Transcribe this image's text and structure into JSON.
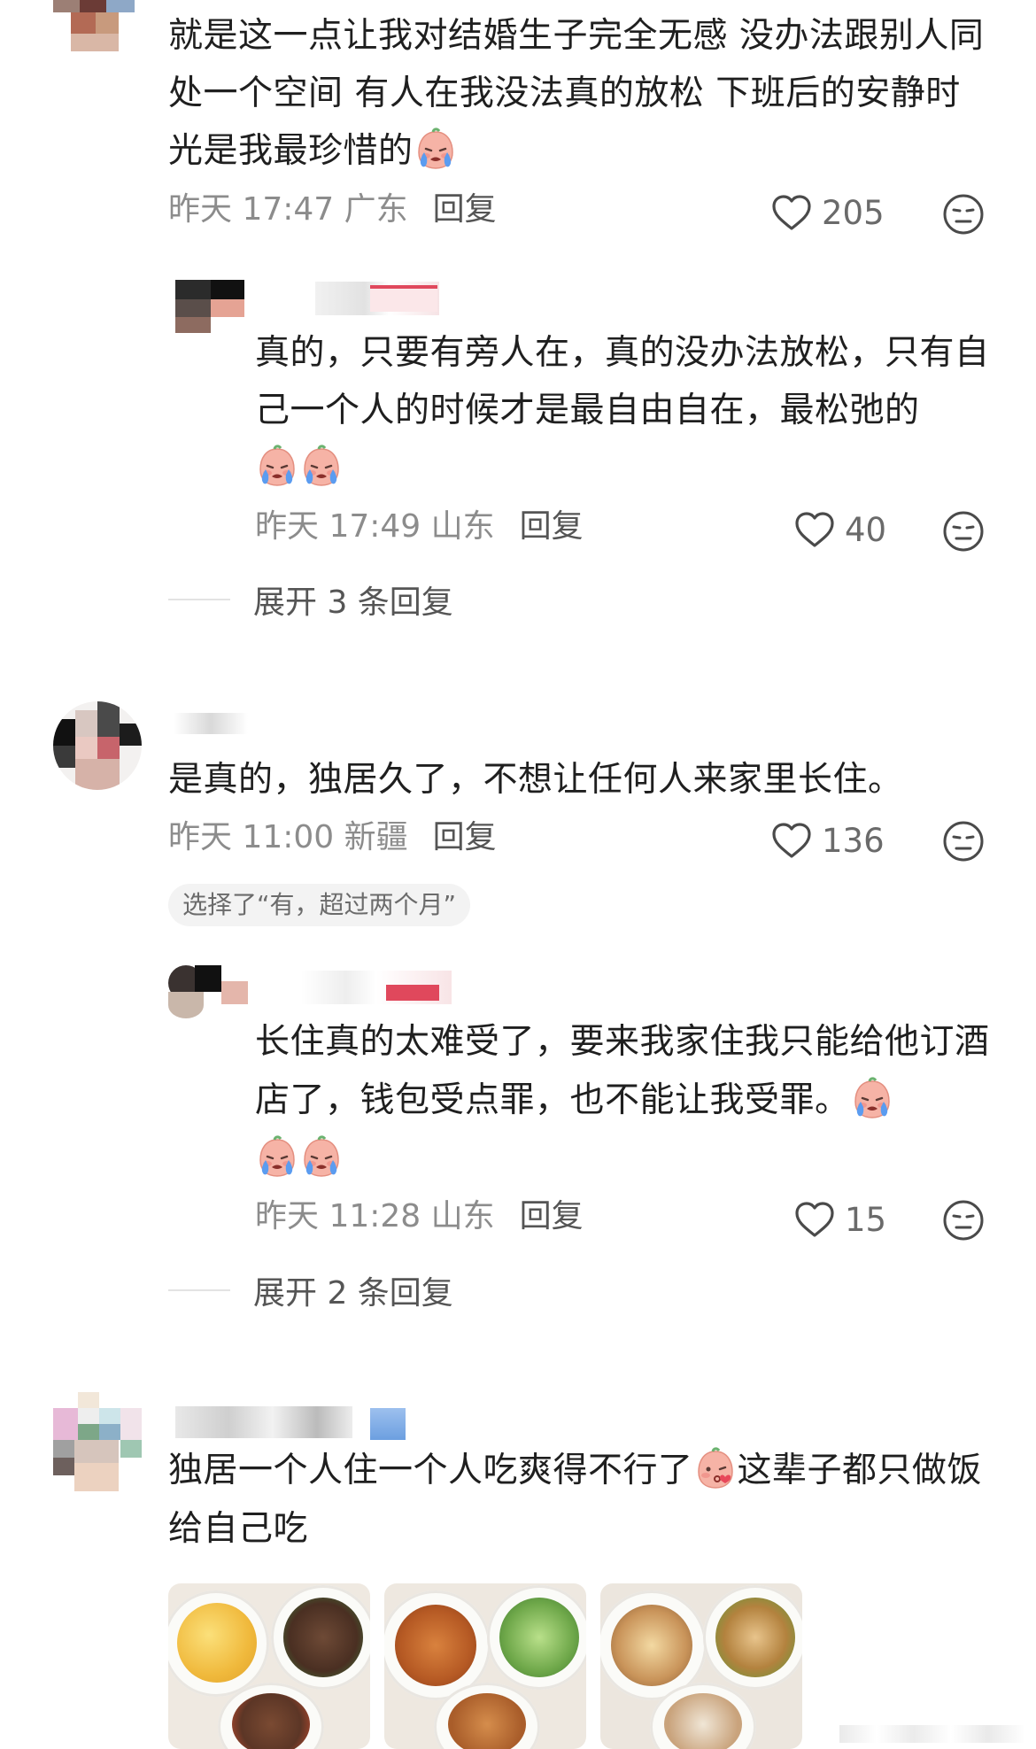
{
  "comments": [
    {
      "text": "就是这一点让我对结婚生子完全无感 没办法跟别人同处一个空间 有人在我没法真的放松 下班后的安静时光是我最珍惜的",
      "emoji": "crying-emoji",
      "time": "昨天 17:47 广东",
      "reply_label": "回复",
      "likes": "205",
      "replies": [
        {
          "text": "真的，只要有旁人在，真的没办法放松，只有自己一个人的时候才是最自由自在，最松弛的",
          "emoji_count": 2,
          "time": "昨天 17:49 山东",
          "reply_label": "回复",
          "likes": "40"
        }
      ],
      "expand": "展开 3 条回复"
    },
    {
      "text": "是真的，独居久了，不想让任何人来家里长住。",
      "time": "昨天 11:00 新疆",
      "reply_label": "回复",
      "likes": "136",
      "chip": "选择了“有，超过两个月”",
      "replies": [
        {
          "text": "长住真的太难受了，要来我家住我只能给他订酒店了，钱包受点罪，也不能让我受罪。",
          "time": "昨天 11:28 山东",
          "reply_label": "回复",
          "likes": "15"
        }
      ],
      "expand": "展开 2 条回复"
    },
    {
      "text_a": "独居一个人住一个人吃爽得不行了",
      "text_b": "这辈子都只做饭给自己吃",
      "emoji": "kissing-emoji"
    }
  ],
  "colors": {
    "text": "#1f1f1f",
    "meta": "#8c8c8c",
    "chip_bg": "#f3f3f3",
    "emoji_skin": "#f6b3a6",
    "tear": "#5b9cf0"
  }
}
